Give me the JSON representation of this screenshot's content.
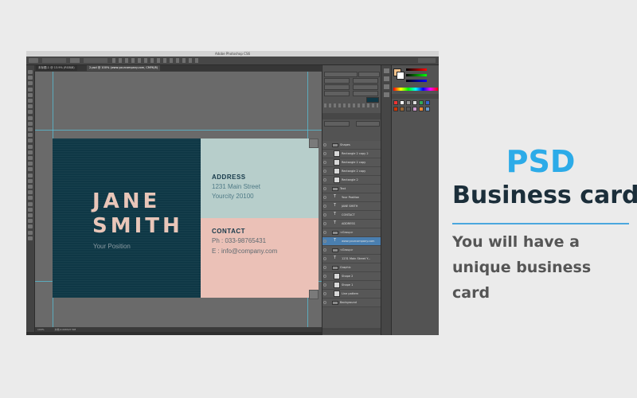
{
  "window": {
    "title": "Adobe Photoshop CS6",
    "doc_tabs": [
      "未标题-1 @ 13.9% (RGB/8)",
      "2.psd @ 100% (www.yourcompany.com, CMYK/8)"
    ],
    "zoom": "100%",
    "status_doc": "文档:2.00M/27.5M"
  },
  "card": {
    "name_line1": "JANE",
    "name_line2": "SMITH",
    "position": "Your Position",
    "address_title": "ADDRESS",
    "address_line1": "1231 Main Street",
    "address_line2": "Yourcity 20100",
    "contact_title": "CONTACT",
    "phone": "Ph  : 033-98765431",
    "email": "E    : info@company.com"
  },
  "colors": {
    "card_dark": "#0f3846",
    "card_teal": "#b7cecb",
    "card_pink": "#ebc1b7",
    "headline_blue": "#2cabe8",
    "headline_dark": "#1b2e3a"
  },
  "layers": [
    {
      "name": "Shapes",
      "type": "group"
    },
    {
      "name": "Rectangle 2 copy 2",
      "type": "shape"
    },
    {
      "name": "Rectangle 2 copy",
      "type": "shape"
    },
    {
      "name": "Rectangle 2 copy",
      "type": "shape"
    },
    {
      "name": "Rectangle 2",
      "type": "shape"
    },
    {
      "name": "Text",
      "type": "group"
    },
    {
      "name": "Your Position",
      "type": "text"
    },
    {
      "name": "JANE SMITH",
      "type": "text"
    },
    {
      "name": "CONTACT",
      "type": "text"
    },
    {
      "name": "ADDRESS",
      "type": "text"
    },
    {
      "name": "<Group>",
      "type": "group"
    },
    {
      "name": "www.yourcompany.com",
      "type": "text",
      "selected": true
    },
    {
      "name": "<Group>",
      "type": "group"
    },
    {
      "name": "1231 Main Street Y...",
      "type": "text"
    },
    {
      "name": "Graphic",
      "type": "group"
    },
    {
      "name": "Shape 2",
      "type": "shape"
    },
    {
      "name": "Shape 1",
      "type": "shape"
    },
    {
      "name": "Line pattern",
      "type": "shape"
    },
    {
      "name": "Background",
      "type": "group"
    }
  ],
  "headline": {
    "psd": "PSD",
    "title": "Business card",
    "tagline": "You will have a unique business card"
  }
}
